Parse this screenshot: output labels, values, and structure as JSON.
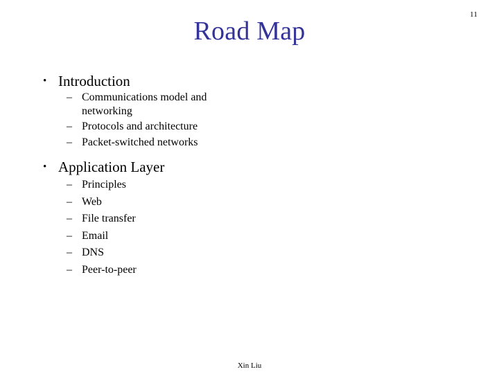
{
  "slide": {
    "title": "Road Map",
    "page_number": "11",
    "footer": "Xin Liu",
    "title_color": "#333399",
    "body_color": "#000000",
    "background_color": "#ffffff",
    "bullet_marker_l1": "•",
    "bullet_marker_l2": "–",
    "topics": [
      {
        "label": "Introduction",
        "items": [
          "Communications model and networking",
          "Protocols and architecture",
          "Packet-switched networks"
        ]
      },
      {
        "label": "Application Layer",
        "items": [
          "Principles",
          "Web",
          "File transfer",
          "Email",
          "DNS",
          "Peer-to-peer"
        ]
      }
    ]
  }
}
